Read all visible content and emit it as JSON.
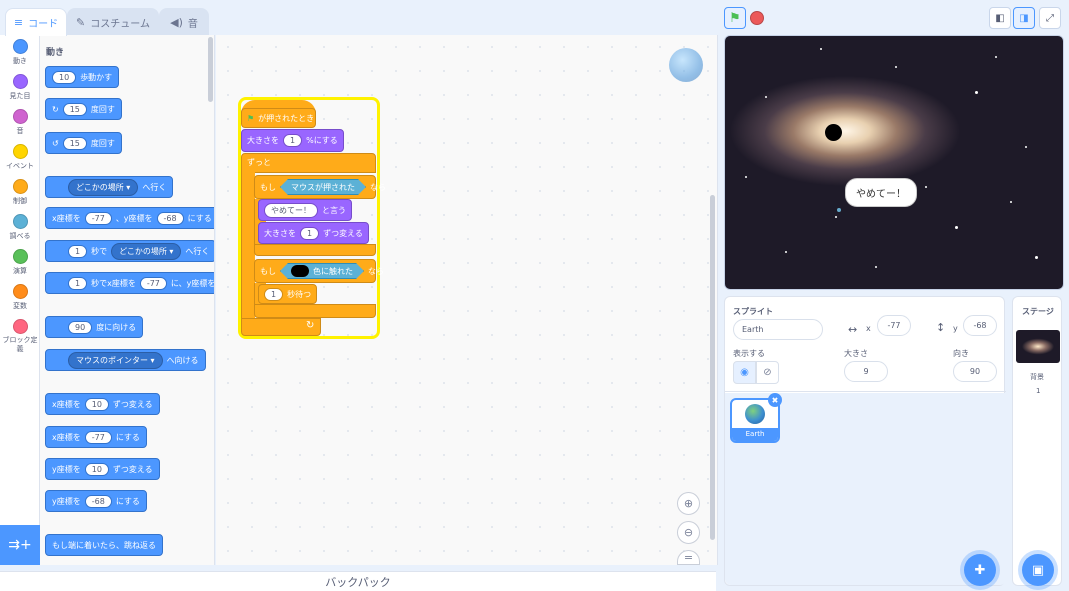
{
  "tabs": {
    "code": "コード",
    "costumes": "コスチューム",
    "sounds": "音"
  },
  "categories": [
    {
      "label": "動き",
      "color": "#4c97ff"
    },
    {
      "label": "見た目",
      "color": "#9966ff"
    },
    {
      "label": "音",
      "color": "#cf63cf"
    },
    {
      "label": "イベント",
      "color": "#ffd500"
    },
    {
      "label": "制御",
      "color": "#ffab19"
    },
    {
      "label": "調べる",
      "color": "#5cb1d6"
    },
    {
      "label": "演算",
      "color": "#59c059"
    },
    {
      "label": "変数",
      "color": "#ff8c1a"
    },
    {
      "label": "ブロック定義",
      "color": "#ff6680"
    }
  ],
  "palette": {
    "title": "動き",
    "move": {
      "v": "10",
      "t": "歩動かす"
    },
    "turn_right": {
      "v": "15",
      "t": "度回す"
    },
    "turn_left": {
      "v": "15",
      "t": "度回す"
    },
    "goto": {
      "d": "どこかの場所",
      "t": "へ行く"
    },
    "gotoxy": {
      "a": "x座標を",
      "x": "-77",
      "b": "、y座標を",
      "y": "-68",
      "c": "にする"
    },
    "glide": {
      "v": "1",
      "a": "秒で",
      "d": "どこかの場所",
      "t": "へ行く"
    },
    "glidexy": {
      "v": "1",
      "a": "秒でx座標を",
      "x": "-77",
      "b": "に、y座標を"
    },
    "point": {
      "v": "90",
      "t": "度に向ける"
    },
    "pointto": {
      "d": "マウスのポインター",
      "t": "へ向ける"
    },
    "changex": {
      "a": "x座標を",
      "v": "10",
      "t": "ずつ変える"
    },
    "setx": {
      "a": "x座標を",
      "v": "-77",
      "t": "にする"
    },
    "changey": {
      "a": "y座標を",
      "v": "10",
      "t": "ずつ変える"
    },
    "sety": {
      "a": "y座標を",
      "v": "-68",
      "t": "にする"
    },
    "bounce": "もし端に着いたら、跳ね返る"
  },
  "script": {
    "hat": "が押されたとき",
    "setsize": {
      "a": "大きさを",
      "v": "1",
      "b": "%にする"
    },
    "forever": "ずっと",
    "if1": {
      "a": "もし",
      "cond": "マウスが押された",
      "b": "なら"
    },
    "say": {
      "v": "やめてー！",
      "b": "と言う"
    },
    "change": {
      "a": "大きさを",
      "v": "1",
      "b": "ずつ変える"
    },
    "if2": {
      "a": "もし",
      "cond": "色に触れた",
      "b": "なら"
    },
    "wait": {
      "v": "1",
      "b": "秒待つ"
    }
  },
  "backpack": "バックパック",
  "stage_bubble": "やめてー！",
  "sprite": {
    "header": "スプライト",
    "name": "Earth",
    "x_label": "x",
    "x": "-77",
    "y_label": "y",
    "y": "-68",
    "show_label": "表示する",
    "size_label": "大きさ",
    "size": "9",
    "dir_label": "向き",
    "dir": "90",
    "thumb_label": "Earth"
  },
  "stage_panel": {
    "header": "ステージ",
    "bg_label": "背景",
    "bg_count": "1"
  },
  "colors": {
    "accent": "#4c97ff",
    "motion": "#4c97ff",
    "control": "#ffab19",
    "looks": "#9966ff",
    "sensing": "#5cb1d6"
  }
}
